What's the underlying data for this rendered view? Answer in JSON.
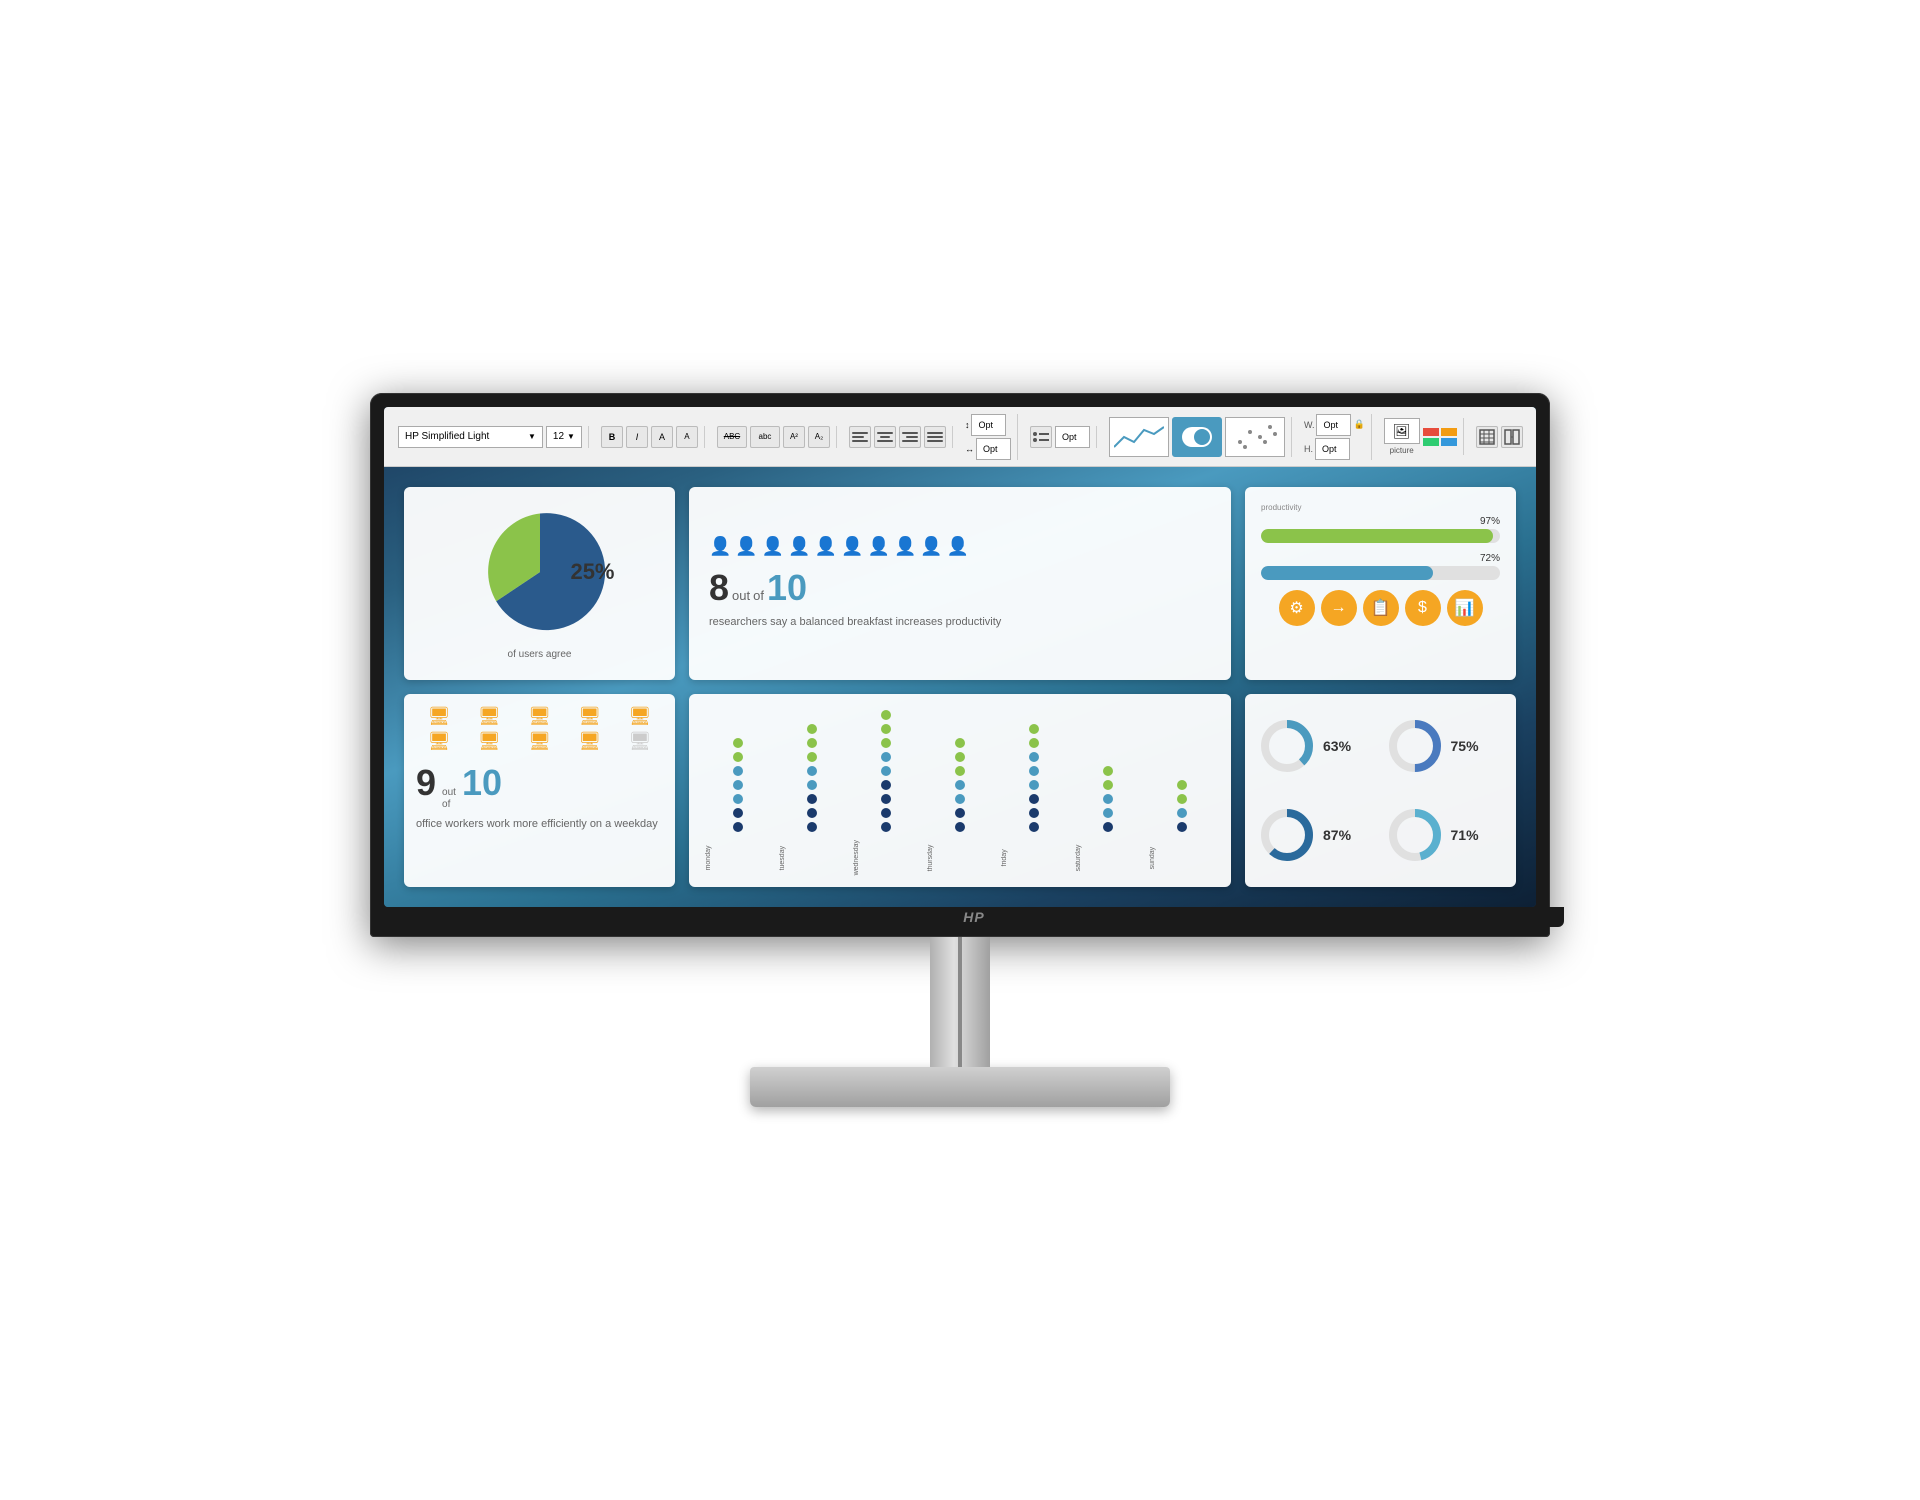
{
  "monitor": {
    "brand": "HP",
    "logo": "hp"
  },
  "toolbar": {
    "font_name": "HP Simplified Light",
    "font_size": "12",
    "bold": "B",
    "italic": "I",
    "font_labels": [
      "A",
      "A"
    ],
    "text_styles": [
      "ABC",
      "abc",
      "A²",
      "A₂"
    ],
    "alignment": [
      "left",
      "center",
      "right",
      "justify"
    ],
    "spacing": "Opt"
  },
  "card_pie": {
    "percent": "25%",
    "label": "of users agree"
  },
  "card_researchers": {
    "num_filled": 8,
    "num_total": 10,
    "pretext": "out",
    "midtext": "of",
    "description": "researchers say a balanced breakfast increases productivity"
  },
  "card_progress": {
    "productivity_label": "productivity",
    "bar1_pct": 97,
    "bar1_label": "97%",
    "bar2_pct": 72,
    "bar2_label": "72%",
    "icons": [
      "⚙",
      "→",
      "📋",
      "$",
      "📊"
    ]
  },
  "card_office": {
    "num": "9",
    "out_of": "out",
    "of": "of",
    "total": "10",
    "description": "office workers work more efficiently on a weekday",
    "monitor_count": 10,
    "grey_count": 1
  },
  "card_dots": {
    "days": [
      "monday",
      "tuesday",
      "wednesday",
      "thursday",
      "friday",
      "saturday",
      "sunday"
    ],
    "columns": [
      {
        "dots": [
          {
            "color": "navy"
          },
          {
            "color": "navy"
          },
          {
            "color": "teal"
          },
          {
            "color": "teal"
          },
          {
            "color": "teal"
          },
          {
            "color": "green"
          },
          {
            "color": "green"
          }
        ]
      },
      {
        "dots": [
          {
            "color": "navy"
          },
          {
            "color": "navy"
          },
          {
            "color": "navy"
          },
          {
            "color": "teal"
          },
          {
            "color": "teal"
          },
          {
            "color": "green"
          },
          {
            "color": "green"
          },
          {
            "color": "green"
          }
        ]
      },
      {
        "dots": [
          {
            "color": "navy"
          },
          {
            "color": "navy"
          },
          {
            "color": "navy"
          },
          {
            "color": "navy"
          },
          {
            "color": "teal"
          },
          {
            "color": "teal"
          },
          {
            "color": "green"
          },
          {
            "color": "green"
          },
          {
            "color": "green"
          }
        ]
      },
      {
        "dots": [
          {
            "color": "navy"
          },
          {
            "color": "navy"
          },
          {
            "color": "teal"
          },
          {
            "color": "teal"
          },
          {
            "color": "green"
          },
          {
            "color": "green"
          },
          {
            "color": "green"
          }
        ]
      },
      {
        "dots": [
          {
            "color": "navy"
          },
          {
            "color": "navy"
          },
          {
            "color": "navy"
          },
          {
            "color": "teal"
          },
          {
            "color": "teal"
          },
          {
            "color": "teal"
          },
          {
            "color": "green"
          },
          {
            "color": "green"
          }
        ]
      },
      {
        "dots": [
          {
            "color": "navy"
          },
          {
            "color": "teal"
          },
          {
            "color": "teal"
          },
          {
            "color": "green"
          },
          {
            "color": "green"
          }
        ]
      },
      {
        "dots": [
          {
            "color": "navy"
          },
          {
            "color": "teal"
          },
          {
            "color": "green"
          },
          {
            "color": "green"
          }
        ]
      }
    ]
  },
  "card_donuts": [
    {
      "pct": 63,
      "label": "63%",
      "color": "#4a9abf"
    },
    {
      "pct": 75,
      "label": "75%",
      "color": "#4a7abf"
    },
    {
      "pct": 87,
      "label": "87%",
      "color": "#2a6a9c"
    },
    {
      "pct": 71,
      "label": "71%",
      "color": "#5ab0cf"
    }
  ]
}
